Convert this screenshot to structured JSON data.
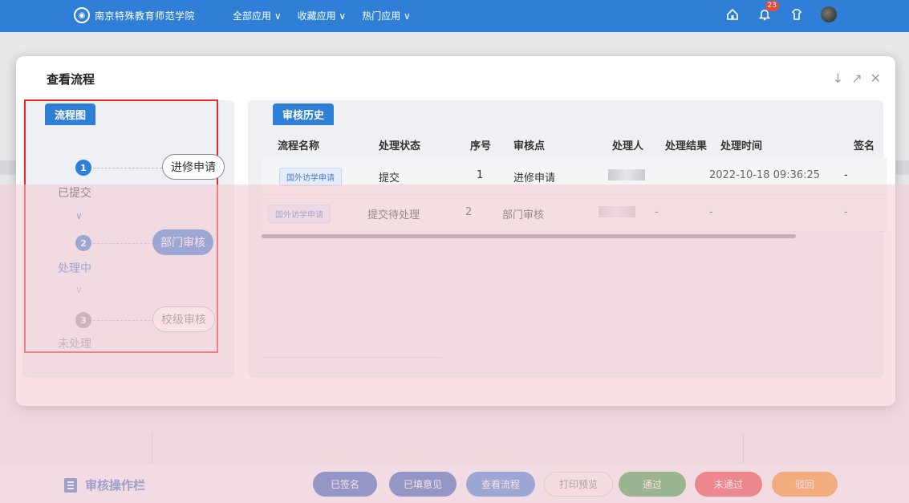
{
  "header": {
    "logo_text": "南京特殊教育师范学院",
    "nav": [
      "全部应用 ∨",
      "收藏应用 ∨",
      "热门应用 ∨"
    ],
    "notification_count": "23"
  },
  "modal": {
    "title": "查看流程",
    "actions": [
      "↓",
      "↗",
      "✕"
    ]
  },
  "flow": {
    "tag": "流程图",
    "steps": [
      {
        "num": "1",
        "label": "进修申请",
        "status": "已提交"
      },
      {
        "num": "2",
        "label": "部门审核",
        "status": "处理中"
      },
      {
        "num": "3",
        "label": "校级审核",
        "status": "未处理"
      }
    ],
    "chevron": "∨"
  },
  "history": {
    "tag": "审核历史",
    "columns": [
      "流程名称",
      "处理状态",
      "序号",
      "审核点",
      "处理人",
      "处理结果",
      "处理时间",
      "签名"
    ],
    "rows": [
      {
        "name": "国外访学申请",
        "status": "提交",
        "seq": "1",
        "node": "进修申请",
        "result": "",
        "time": "2022-10-18 09:36:25",
        "sign": "-"
      },
      {
        "name": "国外访学申请",
        "status": "提交待处理",
        "seq": "2",
        "node": "部门审核",
        "result": "-",
        "time": "-",
        "sign": "-"
      }
    ]
  },
  "bottombar": {
    "title": "审核操作栏",
    "buttons": [
      {
        "label": "已签名",
        "color": "#1e5bb8"
      },
      {
        "label": "已填意见",
        "color": "#1e5bb8"
      },
      {
        "label": "查看流程",
        "color": "#2f7fd6"
      },
      {
        "label": "打印预览",
        "color": "#f0f0f0"
      },
      {
        "label": "通过",
        "color": "#2f9e44"
      },
      {
        "label": "未通过",
        "color": "#e03a3a"
      },
      {
        "label": "驳回",
        "color": "#f08a1a"
      }
    ]
  }
}
